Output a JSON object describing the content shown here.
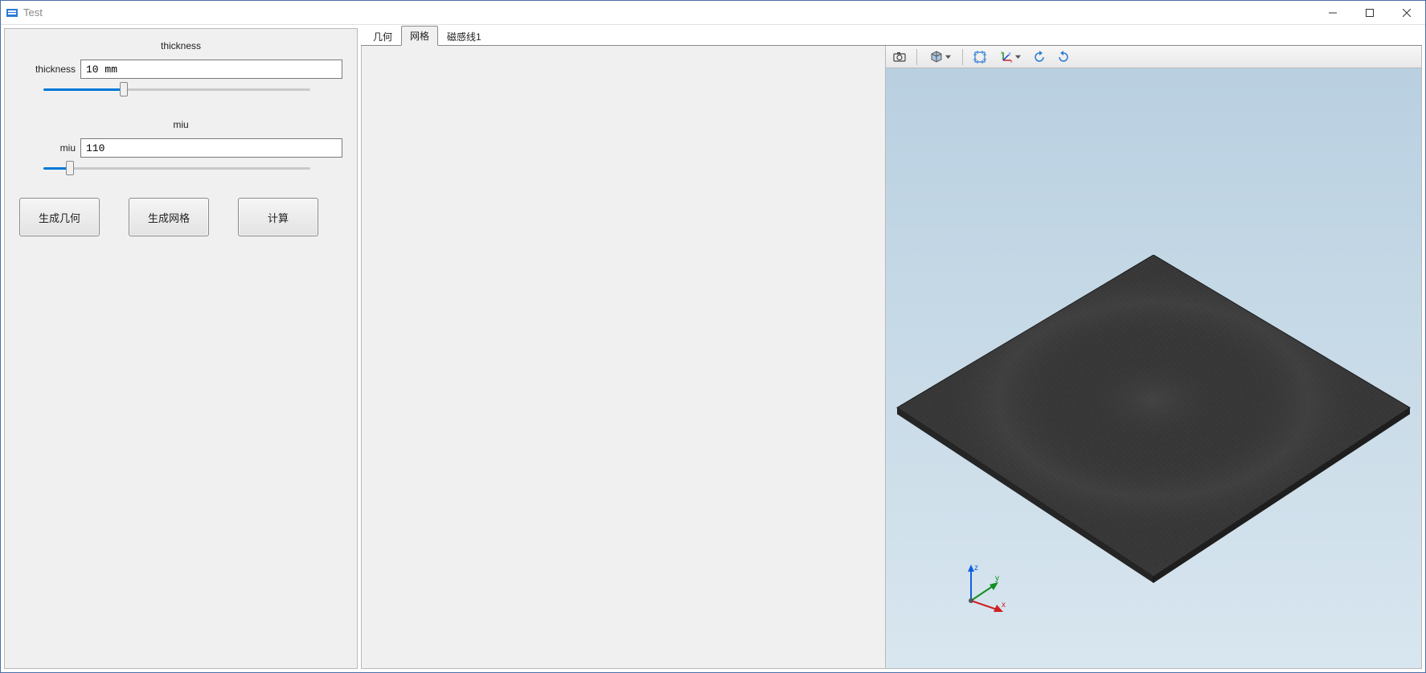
{
  "window": {
    "title": "Test"
  },
  "left_panel": {
    "group1_title": "thickness",
    "thickness_label": "thickness",
    "thickness_value": "10 mm",
    "thickness_slider_pct": 30,
    "group2_title": "miu",
    "miu_label": "miu",
    "miu_value": "110",
    "miu_slider_pct": 10,
    "btn_geom": "生成几何",
    "btn_mesh": "生成网格",
    "btn_calc": "计算"
  },
  "tabs": [
    {
      "label": "几何",
      "active": false
    },
    {
      "label": "网格",
      "active": true
    },
    {
      "label": "磁感线1",
      "active": false
    }
  ],
  "view_toolbar": {
    "icons": [
      "camera-icon",
      "cube-view-icon",
      "fit-view-icon",
      "axis-orient-icon",
      "rotate-left-icon",
      "rotate-right-icon"
    ]
  },
  "axis_labels": {
    "x": "x",
    "y": "y",
    "z": "z"
  }
}
